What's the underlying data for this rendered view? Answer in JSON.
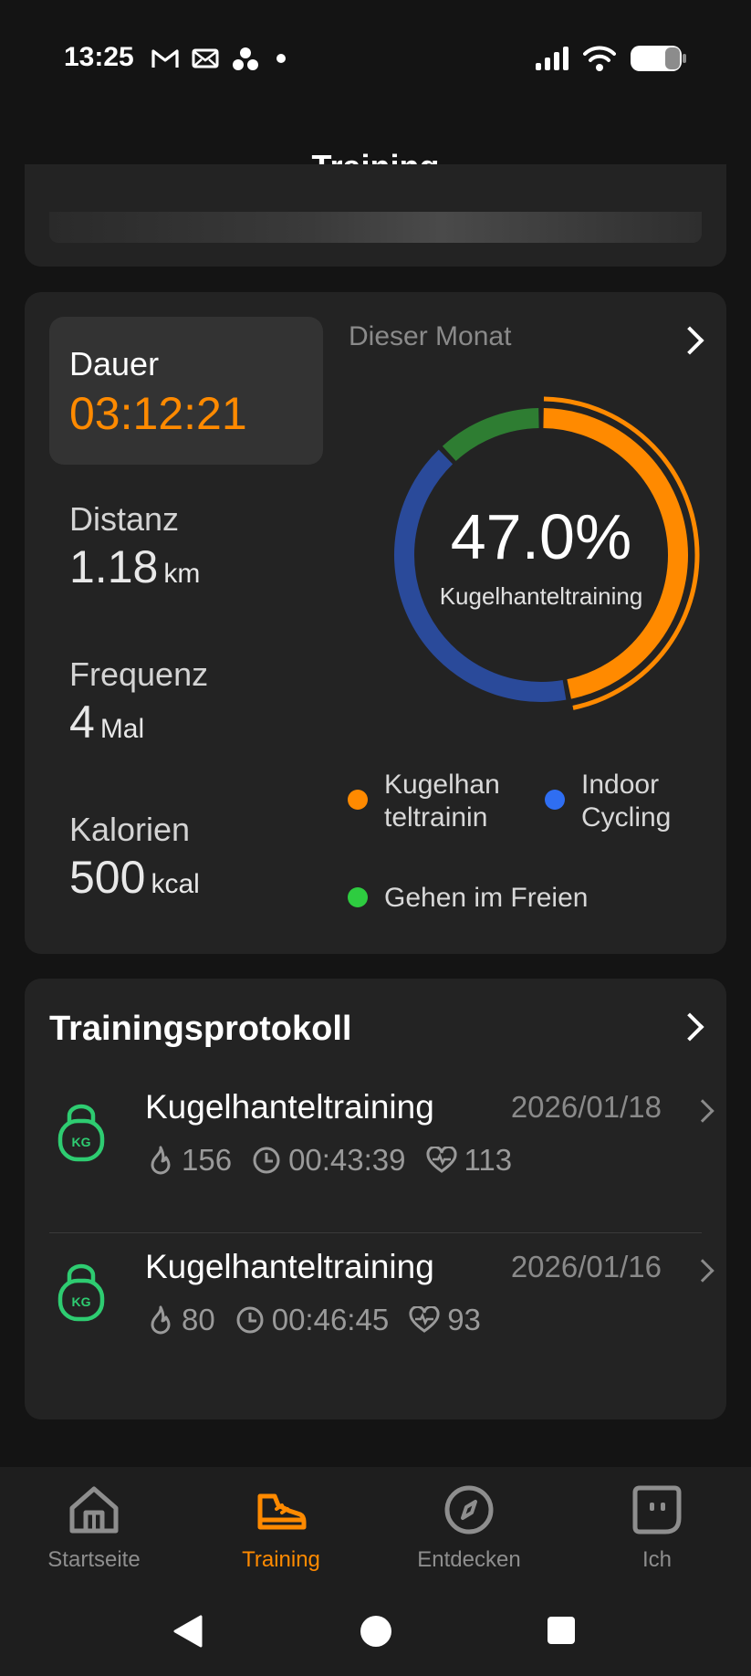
{
  "status_bar": {
    "time": "13:25",
    "left_icons": [
      "gmail-icon",
      "mail-icon",
      "notification-icon",
      "dot-icon"
    ],
    "right_icons": [
      "signal-icon",
      "wifi-icon",
      "battery-icon"
    ]
  },
  "header": {
    "title": "Training"
  },
  "stats": {
    "period_label": "Dieser Monat",
    "dauer": {
      "label": "Dauer",
      "value": "03:12:21"
    },
    "distanz": {
      "label": "Distanz",
      "value": "1.18",
      "unit": "km"
    },
    "frequenz": {
      "label": "Frequenz",
      "value": "4",
      "unit": "Mal"
    },
    "kalorien": {
      "label": "Kalorien",
      "value": "500",
      "unit": "kcal"
    },
    "donut": {
      "percent_label": "47.0%",
      "sub_label": "Kugelhanteltraining",
      "segments": [
        {
          "name": "Kugelhanteltraining",
          "fraction": 0.47,
          "color": "#ff8a00"
        },
        {
          "name": "Indoor Cycling",
          "fraction": 0.41,
          "color": "#2a4a9a"
        },
        {
          "name": "Gehen im Freien",
          "fraction": 0.12,
          "color": "#2e7d32"
        }
      ]
    },
    "legend": [
      {
        "line1": "Kugelhan",
        "line2": "teltrainin",
        "color": "#ff8a00"
      },
      {
        "line1": "Indoor",
        "line2": "Cycling",
        "color": "#2f6ef2"
      },
      {
        "line1": "Gehen im Freien",
        "line2": "",
        "color": "#2ecc40"
      }
    ]
  },
  "log": {
    "title": "Trainingsprotokoll",
    "entries": [
      {
        "name": "Kugelhanteltraining",
        "date": "2026/01/18",
        "calories": "156",
        "duration": "00:43:39",
        "heart_rate": "113"
      },
      {
        "name": "Kugelhanteltraining",
        "date": "2026/01/16",
        "calories": "80",
        "duration": "00:46:45",
        "heart_rate": "93"
      }
    ]
  },
  "kettlebell_label": "KG",
  "tabs": [
    {
      "label": "Startseite",
      "icon": "home-icon",
      "active": false
    },
    {
      "label": "Training",
      "icon": "shoe-icon",
      "active": true
    },
    {
      "label": "Entdecken",
      "icon": "compass-icon",
      "active": false
    },
    {
      "label": "Ich",
      "icon": "profile-icon",
      "active": false
    }
  ],
  "colors": {
    "accent": "#ff8a00",
    "background": "#141414",
    "card": "#232323",
    "kettlebell": "#2ecc71"
  }
}
